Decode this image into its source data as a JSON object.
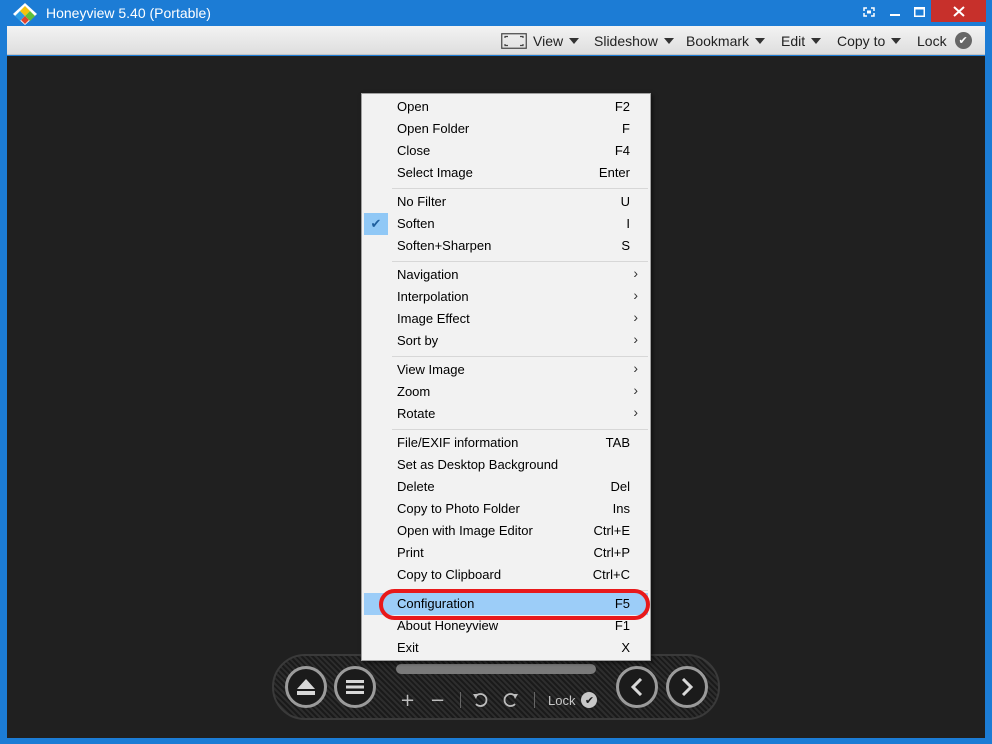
{
  "window": {
    "title": "Honeyview 5.40 (Portable)",
    "icons": [
      "app-diamond-icon",
      "fullscreen-icon",
      "minimize-icon",
      "maximize-icon",
      "close-icon"
    ]
  },
  "toolbar": {
    "view": "View",
    "slideshow": "Slideshow",
    "bookmark": "Bookmark",
    "edit": "Edit",
    "copy_to": "Copy to",
    "lock": "Lock"
  },
  "context_menu": {
    "highlighted": "Configuration",
    "checked": "Soften",
    "items": [
      {
        "label": "Open",
        "shortcut": "F2"
      },
      {
        "label": "Open Folder",
        "shortcut": "F"
      },
      {
        "label": "Close",
        "shortcut": "F4"
      },
      {
        "label": "Select Image",
        "shortcut": "Enter"
      },
      {
        "label": "No Filter",
        "shortcut": "U"
      },
      {
        "label": "Soften",
        "shortcut": "I"
      },
      {
        "label": "Soften+Sharpen",
        "shortcut": "S"
      },
      {
        "label": "Navigation",
        "shortcut": ""
      },
      {
        "label": "Interpolation",
        "shortcut": ""
      },
      {
        "label": "Image Effect",
        "shortcut": ""
      },
      {
        "label": "Sort by",
        "shortcut": ""
      },
      {
        "label": "View Image",
        "shortcut": ""
      },
      {
        "label": "Zoom",
        "shortcut": ""
      },
      {
        "label": "Rotate",
        "shortcut": ""
      },
      {
        "label": "File/EXIF information",
        "shortcut": "TAB"
      },
      {
        "label": "Set as Desktop Background",
        "shortcut": ""
      },
      {
        "label": "Delete",
        "shortcut": "Del"
      },
      {
        "label": "Copy to Photo Folder",
        "shortcut": "Ins"
      },
      {
        "label": "Open with Image Editor",
        "shortcut": "Ctrl+E"
      },
      {
        "label": "Print",
        "shortcut": "Ctrl+P"
      },
      {
        "label": "Copy to Clipboard",
        "shortcut": "Ctrl+C"
      },
      {
        "label": "Configuration",
        "shortcut": "F5"
      },
      {
        "label": "About Honeyview",
        "shortcut": "F1"
      },
      {
        "label": "Exit",
        "shortcut": "X"
      }
    ]
  },
  "controlbar": {
    "lock": "Lock",
    "zoom_in": "+",
    "zoom_out": "−",
    "icons": [
      "eject-icon",
      "menu-icon",
      "rotate-left-icon",
      "rotate-right-icon",
      "prev-icon",
      "next-icon"
    ]
  },
  "colors": {
    "frame": "#1c7cd5",
    "viewer_bg": "#202020",
    "highlight": "#9ccdf8",
    "annotation_ring": "#e8191b"
  }
}
